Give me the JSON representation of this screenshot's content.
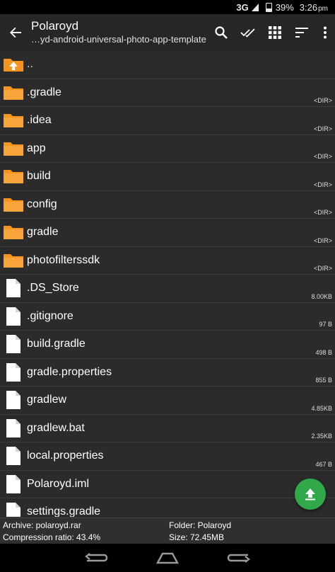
{
  "status_bar": {
    "network": "3G",
    "battery_percent": "39%",
    "time": "3:26",
    "time_suffix": "pm"
  },
  "app_bar": {
    "title": "Polaroyd",
    "subtitle": "…yd-android-universal-photo-app-template",
    "icons": [
      "back-arrow-icon",
      "search-icon",
      "double-check-icon",
      "grid-icon",
      "sort-icon",
      "more-vert-icon"
    ]
  },
  "files": [
    {
      "name": "..",
      "meta": "",
      "type": "parent"
    },
    {
      "name": ".gradle",
      "meta": "<DIR>",
      "type": "folder"
    },
    {
      "name": ".idea",
      "meta": "<DIR>",
      "type": "folder"
    },
    {
      "name": "app",
      "meta": "<DIR>",
      "type": "folder"
    },
    {
      "name": "build",
      "meta": "<DIR>",
      "type": "folder"
    },
    {
      "name": "config",
      "meta": "<DIR>",
      "type": "folder"
    },
    {
      "name": "gradle",
      "meta": "<DIR>",
      "type": "folder"
    },
    {
      "name": "photofilterssdk",
      "meta": "<DIR>",
      "type": "folder"
    },
    {
      "name": ".DS_Store",
      "meta": "8.00KB",
      "type": "file"
    },
    {
      "name": ".gitignore",
      "meta": "97 B",
      "type": "file"
    },
    {
      "name": "build.gradle",
      "meta": "498 B",
      "type": "file"
    },
    {
      "name": "gradle.properties",
      "meta": "855 B",
      "type": "file"
    },
    {
      "name": "gradlew",
      "meta": "4.85KB",
      "type": "file"
    },
    {
      "name": "gradlew.bat",
      "meta": "2.35KB",
      "type": "file"
    },
    {
      "name": "local.properties",
      "meta": "467 B",
      "type": "file"
    },
    {
      "name": "Polaroyd.iml",
      "meta": "",
      "type": "file"
    },
    {
      "name": "settings.gradle",
      "meta": "",
      "type": "file"
    }
  ],
  "info": {
    "archive": "Archive: polaroyd.rar",
    "folder": "Folder: Polaroyd",
    "compression": "Compression ratio: 43.4%",
    "size": "Size: 72.45MB"
  },
  "colors": {
    "folder": "#f7941d",
    "fab": "#31a84a",
    "background": "#2b2b2b"
  },
  "nav_icons": [
    "back-nav-icon",
    "home-nav-icon",
    "recents-nav-icon"
  ]
}
